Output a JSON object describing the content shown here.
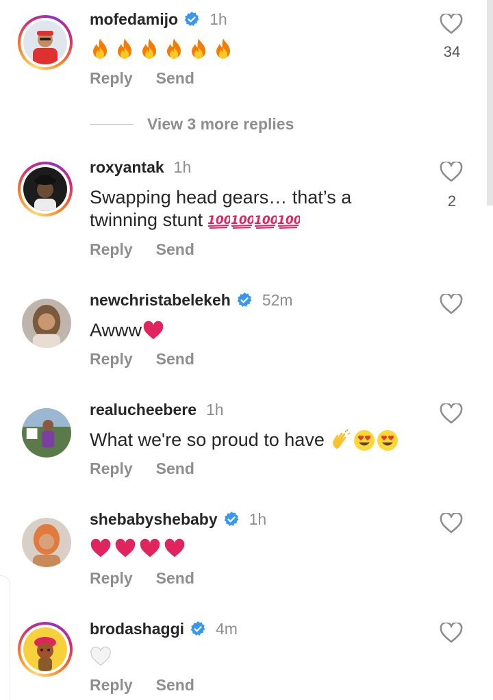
{
  "comments": [
    {
      "username": "mofedamijo",
      "verified": true,
      "time": "1h",
      "text": "",
      "emoji_type": "fire",
      "emoji_count": 6,
      "likes": "34",
      "reply_label": "Reply",
      "send_label": "Send"
    },
    {
      "username": "roxyantak",
      "verified": false,
      "time": "1h",
      "text_line1": "Swapping head gears… that’s a",
      "text_line2": "twinning stunt",
      "emoji_type": "hundred",
      "emoji_count": 4,
      "likes": "2",
      "reply_label": "Reply",
      "send_label": "Send"
    },
    {
      "username": "newchristabelekeh",
      "verified": true,
      "time": "52m",
      "text": "Awww",
      "emoji_type": "red-heart",
      "likes": "",
      "reply_label": "Reply",
      "send_label": "Send"
    },
    {
      "username": "realucheebere",
      "verified": false,
      "time": "1h",
      "text": "What we're so proud to have",
      "emoji_type": "clap-heart-eyes",
      "likes": "",
      "reply_label": "Reply",
      "send_label": "Send"
    },
    {
      "username": "shebabyshebaby",
      "verified": true,
      "time": "1h",
      "text": "",
      "emoji_type": "red-heart",
      "emoji_count": 4,
      "likes": "",
      "reply_label": "Reply",
      "send_label": "Send"
    },
    {
      "username": "brodashaggi",
      "verified": true,
      "time": "4m",
      "text": "",
      "emoji_type": "white-heart",
      "likes": "",
      "reply_label": "Reply",
      "send_label": "Send"
    }
  ],
  "view_more_replies": "View 3 more replies",
  "icons": {
    "like": "heart-outline-icon",
    "verified": "verified-badge-icon"
  },
  "colors": {
    "verified_blue": "#3897f0",
    "muted_text": "#8e8e8e",
    "primary_text": "#262626"
  }
}
